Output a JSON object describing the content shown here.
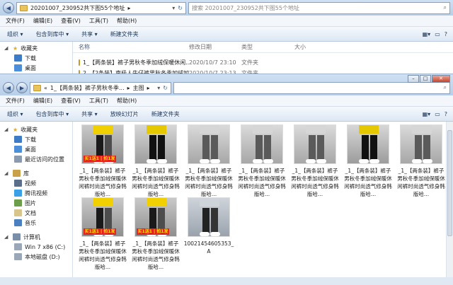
{
  "back_window": {
    "path_segments": [
      "20201007_230952共下图55个地址"
    ],
    "search_placeholder": "搜索 20201007_230952共下图55个地址",
    "menu": [
      "文件(F)",
      "编辑(E)",
      "查看(V)",
      "工具(T)",
      "帮助(H)"
    ],
    "toolbar": [
      "组织 ▾",
      "包含到库中 ▾",
      "共享 ▾",
      "新建文件夹"
    ],
    "nav": {
      "favorites": "收藏夹",
      "items": [
        "下载",
        "桌面"
      ]
    },
    "columns": [
      "名称",
      "修改日期",
      "类型",
      "大小"
    ],
    "rows": [
      {
        "name": "1_【两条装】裤子男秋冬季加绒保暖休闲...",
        "date": "2020/10/7 23:10",
        "type": "文件夹",
        "size": ""
      },
      {
        "name": "2_【2条装】南极人牛仔裤男秋冬季加绒加...",
        "date": "2020/10/7 23:13",
        "type": "文件夹",
        "size": ""
      }
    ]
  },
  "front_window": {
    "path_prefix": "«",
    "path_segments": [
      "1_【两条装】裤子男秋冬季...",
      "主图"
    ],
    "menu": [
      "文件(F)",
      "编辑(E)",
      "查看(V)",
      "工具(T)",
      "帮助(H)"
    ],
    "toolbar": [
      "组织 ▾",
      "包含到库中 ▾",
      "共享 ▾",
      "放映幻灯片",
      "新建文件夹"
    ],
    "nav": {
      "favorites": "收藏夹",
      "fav_items": [
        "下载",
        "桌面",
        "最近访问的位置"
      ],
      "library": "库",
      "lib_items": [
        "视频",
        "腾讯视频",
        "图片",
        "文档",
        "音乐"
      ],
      "computer": "计算机",
      "comp_items": [
        "Win 7 x86 (C:)",
        "本地磁盘 (D:)"
      ]
    },
    "files": [
      {
        "caption": "_1_【两条装】裤子男秋冬季加绒保暖休闲裤时尚透气修身韩版哈...",
        "badge": "买1送1 | 拍1发2",
        "style": "a"
      },
      {
        "caption": "_1_【两条装】裤子男秋冬季加绒保暖休闲裤时尚透气修身韩版哈...",
        "badge": "",
        "style": "b"
      },
      {
        "caption": "_1_【两条装】裤子男秋冬季加绒保暖休闲裤时尚透气修身韩版哈...",
        "badge": "",
        "style": "c"
      },
      {
        "caption": "_1_【两条装】裤子男秋冬季加绒保暖休闲裤时尚透气修身韩版哈...",
        "badge": "",
        "style": "c"
      },
      {
        "caption": "_1_【两条装】裤子男秋冬季加绒保暖休闲裤时尚透气修身韩版哈...",
        "badge": "",
        "style": "c"
      },
      {
        "caption": "_1_【两条装】裤子男秋冬季加绒保暖休闲裤时尚透气修身韩版哈...",
        "badge": "",
        "style": "b"
      },
      {
        "caption": "_1_【两条装】裤子男秋冬季加绒保暖休闲裤时尚透气修身韩版哈...",
        "badge": "",
        "style": "c"
      },
      {
        "caption": "_1_【两条装】裤子男秋冬季加绒保暖休闲裤时尚透气修身韩版哈...",
        "badge": "买1送1 | 拍1发2",
        "style": "a"
      },
      {
        "caption": "_1_【两条装】裤子男秋冬季加绒保暖休闲裤时尚透气修身韩版哈...",
        "badge": "买1送1 | 拍1发2",
        "style": "a"
      },
      {
        "caption": "10021454605353_A",
        "badge": "",
        "style": "d"
      }
    ]
  }
}
